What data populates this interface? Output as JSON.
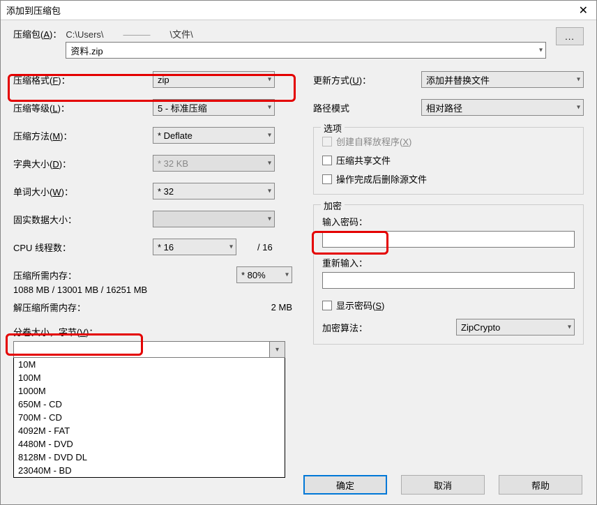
{
  "title": "添加到压缩包",
  "close_glyph": "✕",
  "archive": {
    "label_prefix": "压缩包(",
    "label_key": "A",
    "label_suffix": ")：",
    "path_prefix": "C:\\Users\\",
    "path_masked": "———",
    "path_suffix": "\\文件\\",
    "filename": "资料.zip",
    "browse": "..."
  },
  "left": {
    "format_label_prefix": "压缩格式(",
    "format_key": "F",
    "format_label_suffix": ")：",
    "format_value": "zip",
    "level_label_prefix": "压缩等级(",
    "level_key": "L",
    "level_label_suffix": ")：",
    "level_value": "5 - 标准压缩",
    "method_label_prefix": "压缩方法(",
    "method_key": "M",
    "method_label_suffix": ")：",
    "method_value": "* Deflate",
    "dict_label_prefix": "字典大小(",
    "dict_key": "D",
    "dict_label_suffix": ")：",
    "dict_value": "* 32 KB",
    "word_label_prefix": "单词大小(",
    "word_key": "W",
    "word_label_suffix": ")：",
    "word_value": "* 32",
    "solid_label": "固实数据大小：",
    "solid_value": "",
    "cpu_label": "CPU 线程数：",
    "cpu_value": "* 16",
    "cpu_total": "/ 16",
    "mem_compress_label": "压缩所需内存：",
    "mem_compress_value": "1088 MB / 13001 MB / 16251 MB",
    "mem_pct": "* 80%",
    "mem_decompress_label": "解压缩所需内存：",
    "mem_decompress_value": "2 MB",
    "volume_label_prefix": "分卷大小，字节(",
    "volume_key": "V",
    "volume_label_suffix": ")：",
    "volume_value": "",
    "volume_options": [
      "10M",
      "100M",
      "1000M",
      "650M - CD",
      "700M - CD",
      "4092M - FAT",
      "4480M - DVD",
      "8128M - DVD DL",
      "23040M - BD"
    ]
  },
  "right": {
    "update_label_prefix": "更新方式(",
    "update_key": "U",
    "update_label_suffix": ")：",
    "update_value": "添加并替换文件",
    "pathmode_label": "路径模式",
    "pathmode_value": "相对路径",
    "options_title": "选项",
    "opt_sfx_prefix": "创建自释放程序(",
    "opt_sfx_key": "X",
    "opt_sfx_suffix": ")",
    "opt_shared": "压缩共享文件",
    "opt_delete": "操作完成后删除源文件",
    "encrypt_title": "加密",
    "enc_enter": "输入密码：",
    "enc_reenter": "重新输入：",
    "enc_show_prefix": "显示密码(",
    "enc_show_key": "S",
    "enc_show_suffix": ")",
    "enc_algo_label": "加密算法：",
    "enc_algo_value": "ZipCrypto"
  },
  "buttons": {
    "ok": "确定",
    "cancel": "取消",
    "help": "帮助"
  }
}
